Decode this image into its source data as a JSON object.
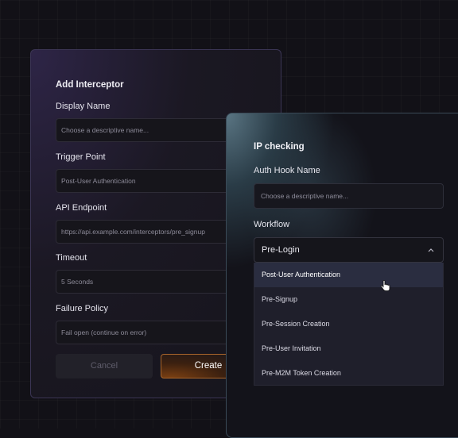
{
  "add_interceptor": {
    "title": "Add Interceptor",
    "display_name_label": "Display Name",
    "display_name_placeholder": "Choose a descriptive name...",
    "trigger_point_label": "Trigger Point",
    "trigger_point_value": "Post-User Authentication",
    "api_endpoint_label": "API Endpoint",
    "api_endpoint_value": "https://api.example.com/interceptors/pre_signup",
    "timeout_label": "Timeout",
    "timeout_value": "5  Seconds",
    "failure_policy_label": "Failure Policy",
    "failure_policy_value": "Fail open (continue on error)",
    "cancel_label": "Cancel",
    "create_label": "Create"
  },
  "ip_checking": {
    "title": "IP checking",
    "auth_hook_label": "Auth Hook Name",
    "auth_hook_placeholder": "Choose a descriptive name...",
    "workflow_label": "Workflow",
    "workflow_selected": "Pre-Login",
    "options": [
      "Post-User Authentication",
      "Pre-Signup",
      "Pre-Session Creation",
      "Pre-User Invitation",
      "Pre-M2M Token Creation"
    ],
    "highlighted_index": 0
  },
  "icons": {
    "chevron": "chevron-up-icon",
    "cursor": "pointer-hand-cursor"
  },
  "colors": {
    "background": "#121117",
    "create_border": "#a8652b",
    "menu_highlight": "#2a2d40"
  }
}
